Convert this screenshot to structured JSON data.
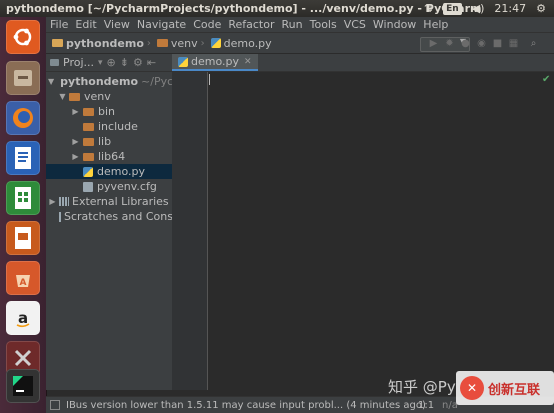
{
  "window": {
    "title": "pythondemo [~/PycharmProjects/pythondemo] - .../venv/demo.py - PyCharm"
  },
  "tray": {
    "keyboard": "En",
    "time": "21:47"
  },
  "menu": [
    "File",
    "Edit",
    "View",
    "Navigate",
    "Code",
    "Refactor",
    "Run",
    "Tools",
    "VCS",
    "Window",
    "Help"
  ],
  "breadcrumbs": [
    "pythondemo",
    "venv",
    "demo.py"
  ],
  "project_panel": {
    "header": "Proj..."
  },
  "tree": [
    {
      "label": "pythondemo",
      "suffix": "~/PycharmProjects/pythondemo",
      "type": "folder"
    },
    {
      "label": "venv",
      "type": "folder"
    },
    {
      "label": "bin",
      "type": "folder"
    },
    {
      "label": "include",
      "type": "folder"
    },
    {
      "label": "lib",
      "type": "folder"
    },
    {
      "label": "lib64",
      "type": "folder"
    },
    {
      "label": "demo.py",
      "type": "python",
      "selected": true
    },
    {
      "label": "pyvenv.cfg",
      "type": "config"
    },
    {
      "label": "External Libraries",
      "type": "library"
    },
    {
      "label": "Scratches and Consoles",
      "type": "scratch"
    }
  ],
  "editor": {
    "tab_label": "demo.py",
    "content": ""
  },
  "status": {
    "message": "IBus version lower than 1.5.11 may cause input probl... (4 minutes ago)",
    "position": "1:1",
    "extra": "n/a"
  },
  "watermark": {
    "text1": "知乎 @Py",
    "text2": "创新互联"
  },
  "colors": {
    "selection": "#0d293e",
    "editor_bg": "#2b2b2b",
    "panel_bg": "#3c3f41",
    "tab_underline": "#4a88c7"
  }
}
